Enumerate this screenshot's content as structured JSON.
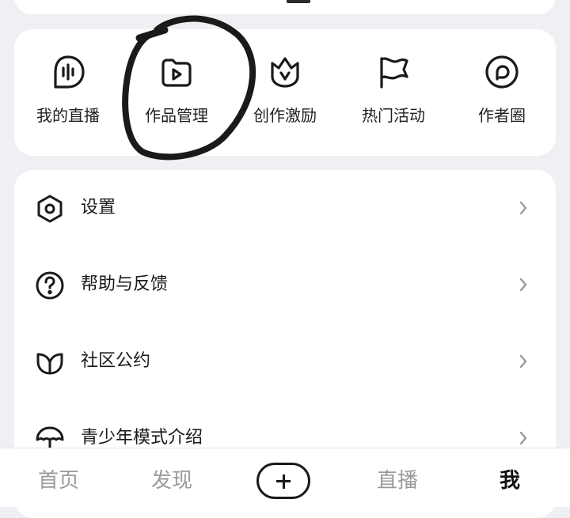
{
  "tools": [
    {
      "label": "我的直播",
      "icon": "live-stream-icon"
    },
    {
      "label": "作品管理",
      "icon": "video-folder-icon"
    },
    {
      "label": "创作激励",
      "icon": "crown-icon"
    },
    {
      "label": "热门活动",
      "icon": "flag-icon"
    },
    {
      "label": "作者圈",
      "icon": "chat-circle-icon"
    }
  ],
  "menu": [
    {
      "label": "设置",
      "icon": "hexagon-gear-icon"
    },
    {
      "label": "帮助与反馈",
      "icon": "question-circle-icon"
    },
    {
      "label": "社区公约",
      "icon": "leaf-icon"
    },
    {
      "label": "青少年模式介绍",
      "icon": "umbrella-icon"
    }
  ],
  "tabbar": {
    "home": "首页",
    "discover": "发现",
    "post_icon": "plus-icon",
    "live": "直播",
    "me": "我",
    "active": "me"
  }
}
